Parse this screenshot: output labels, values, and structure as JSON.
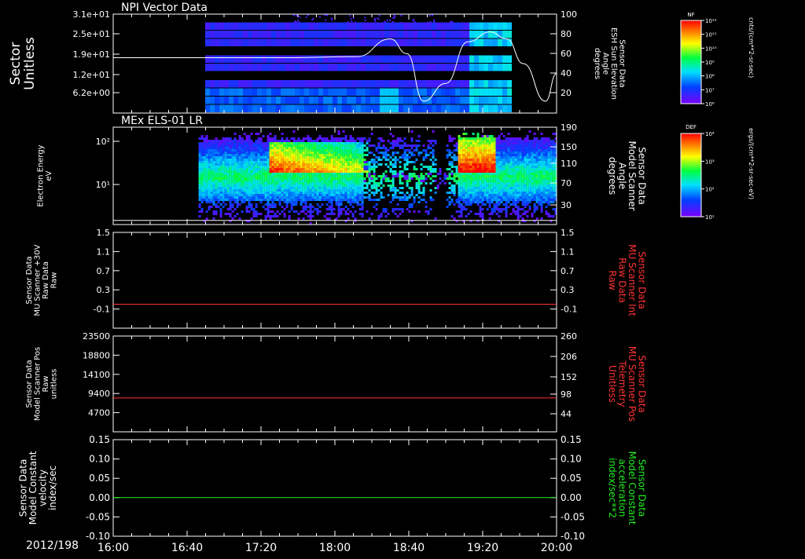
{
  "date_label": "2012/198",
  "time_ticks": [
    "16:00",
    "16:40",
    "17:20",
    "18:00",
    "18:40",
    "19:20",
    "20:00"
  ],
  "colorbars": [
    {
      "label": "NF",
      "unit": "cnts/(cm**2-sr-sec)",
      "tick_labels": [
        "10¹²",
        "10¹¹",
        "10¹⁰",
        "10⁹",
        "10⁸",
        "10⁷",
        "10⁶"
      ]
    },
    {
      "label": "DEF",
      "unit": "ergs/(cm**2-sr-sec-eV)",
      "tick_labels": [
        "10⁴",
        "10³",
        "10²",
        "10¹"
      ]
    }
  ],
  "chart_data": [
    {
      "type": "heatmap",
      "title": "NPI Vector Data",
      "ylabel": [
        "Sector",
        "Unitless"
      ],
      "yticks": [
        "3.1e+01",
        "2.5e+01",
        "1.9e+01",
        "1.2e+01",
        "6.2e+00"
      ],
      "y2label": [
        "Sensor Data",
        "ESH Sun Elevation",
        "Angle",
        "degrees"
      ],
      "y2ticks": [
        "100",
        "80",
        "60",
        "40",
        "20"
      ],
      "y2lim": [
        0,
        100
      ],
      "overlay_line": {
        "axis": "right",
        "x_hours": [
          16.0,
          16.4,
          17.0,
          17.6,
          18.2,
          18.5,
          18.65,
          18.8,
          19.0,
          19.2,
          19.4,
          19.55,
          19.7,
          19.9,
          20.0
        ],
        "values": [
          56,
          56,
          56,
          56,
          57,
          75,
          60,
          12,
          30,
          72,
          82,
          75,
          50,
          12,
          40
        ]
      }
    },
    {
      "type": "heatmap",
      "title": "MEx ELS-01 LR",
      "ylabel": [
        "Electron Energy",
        "eV"
      ],
      "yticks": [
        "10²",
        "10¹"
      ],
      "y2label": [
        "Sensor Data",
        "Model Scanner",
        "Angle",
        "degrees"
      ],
      "y2ticks": [
        "190",
        "150",
        "110",
        "70",
        "30"
      ],
      "y2lim": [
        0,
        190
      ],
      "overlay_line": {
        "axis": "right",
        "x_hours": [
          16.0,
          20.0
        ],
        "values": [
          8,
          8
        ]
      }
    },
    {
      "type": "line",
      "ylabel": [
        "Sensor Data",
        "MU Scanner +30V",
        "Raw Data",
        "Raw"
      ],
      "yticks": [
        "1.5",
        "1.1",
        "0.7",
        "0.3",
        "-0.1"
      ],
      "ylim": [
        -0.5,
        1.5
      ],
      "y2label": [
        "Sensor Data",
        "MU Scanner Int",
        "Raw Data",
        "Raw"
      ],
      "y2ticks": [
        "1.5",
        "1.1",
        "0.7",
        "0.3",
        "-0.1"
      ],
      "series": [
        {
          "color": "#ff3333",
          "x_hours": [
            16.0,
            20.0
          ],
          "values": [
            0.0,
            0.0
          ]
        }
      ]
    },
    {
      "type": "line",
      "ylabel": [
        "Sensor Data",
        "Model Scanner Pos",
        "Raw",
        "unitless"
      ],
      "yticks": [
        "23500",
        "18800",
        "14100",
        "9400",
        "4700"
      ],
      "ylim": [
        0,
        23500
      ],
      "y2label": [
        "Sensor Data",
        "MU Scanner Pos",
        "Telemetry",
        "Unitless"
      ],
      "y2ticks": [
        "260",
        "206",
        "152",
        "98",
        "44"
      ],
      "series": [
        {
          "color": "#ff3333",
          "x_hours": [
            16.0,
            20.0
          ],
          "values": [
            8300,
            8300
          ]
        }
      ]
    },
    {
      "type": "line",
      "ylabel": [
        "Sensor Data",
        "Model Constant",
        "velocity",
        "index/sec"
      ],
      "yticks": [
        "0.15",
        "0.10",
        "0.05",
        "0.00",
        "-0.05",
        "-0.10"
      ],
      "ylim": [
        -0.1,
        0.15
      ],
      "y2label": [
        "Sensor Data",
        "Model Constant",
        "acceleration",
        "index/sec**2"
      ],
      "y2ticks": [
        "0.15",
        "0.10",
        "0.05",
        "0.00",
        "-0.05",
        "-0.10"
      ],
      "series": [
        {
          "color": "#22ee22",
          "x_hours": [
            16.0,
            20.0
          ],
          "values": [
            0.0,
            0.0
          ]
        }
      ]
    }
  ]
}
